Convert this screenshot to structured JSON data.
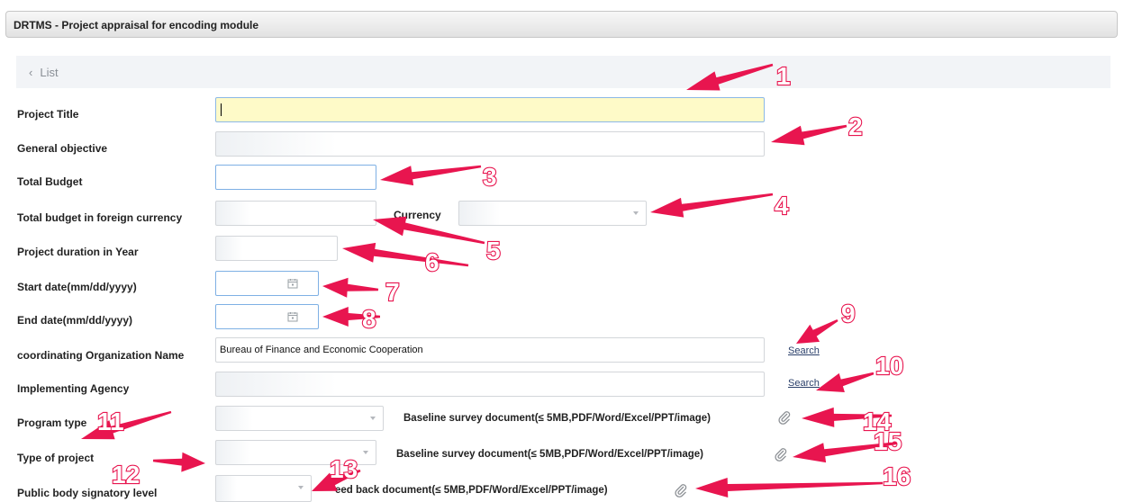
{
  "panel": {
    "title": "DRTMS - Project appraisal for encoding module"
  },
  "nav": {
    "back_icon": "‹",
    "list_label": "List"
  },
  "fields": {
    "project_title": {
      "label": "Project Title",
      "value": ""
    },
    "general_objective": {
      "label": "General objective",
      "value": ""
    },
    "total_budget": {
      "label": "Total Budget",
      "value": ""
    },
    "total_budget_foreign": {
      "label": "Total budget in foreign currency",
      "value": ""
    },
    "currency": {
      "label": "Currency",
      "selected": ""
    },
    "project_duration": {
      "label": "Project duration in Year",
      "value": ""
    },
    "start_date": {
      "label": "Start date(mm/dd/yyyy)",
      "value": ""
    },
    "end_date": {
      "label": "End date(mm/dd/yyyy)",
      "value": ""
    },
    "coordinating_org": {
      "label": "coordinating Organization Name",
      "value": "Bureau of Finance and Economic Cooperation",
      "search_label": "Search"
    },
    "implementing_agency": {
      "label": "Implementing Agency",
      "value": "",
      "search_label": "Search"
    },
    "program_type": {
      "label": "Program type",
      "selected": ""
    },
    "type_of_project": {
      "label": "Type of project",
      "selected": ""
    },
    "public_body_signatory": {
      "label": "Public body signatory level",
      "selected": ""
    }
  },
  "documents": {
    "baseline_1": "Baseline survey document(≤ 5MB,PDF/Word/Excel/PPT/image)",
    "baseline_2": "Baseline survey document(≤ 5MB,PDF/Word/Excel/PPT/image)",
    "feedback": "eed back document(≤ 5MB,PDF/Word/Excel/PPT/image)"
  },
  "annotations": {
    "color": "#e8154f",
    "numbers": [
      "1",
      "2",
      "3",
      "4",
      "5",
      "6",
      "7",
      "8",
      "9",
      "10",
      "11",
      "12",
      "13",
      "14",
      "15",
      "16"
    ]
  },
  "colors": {
    "header_gradient_top": "#f7f7f7",
    "focus_yellow": "#fefac8",
    "link": "#2a3f6a"
  },
  "icons": {
    "calendar": "calendar-icon",
    "attachment": "paperclip-icon",
    "dropdown": "chevron-down-icon"
  }
}
